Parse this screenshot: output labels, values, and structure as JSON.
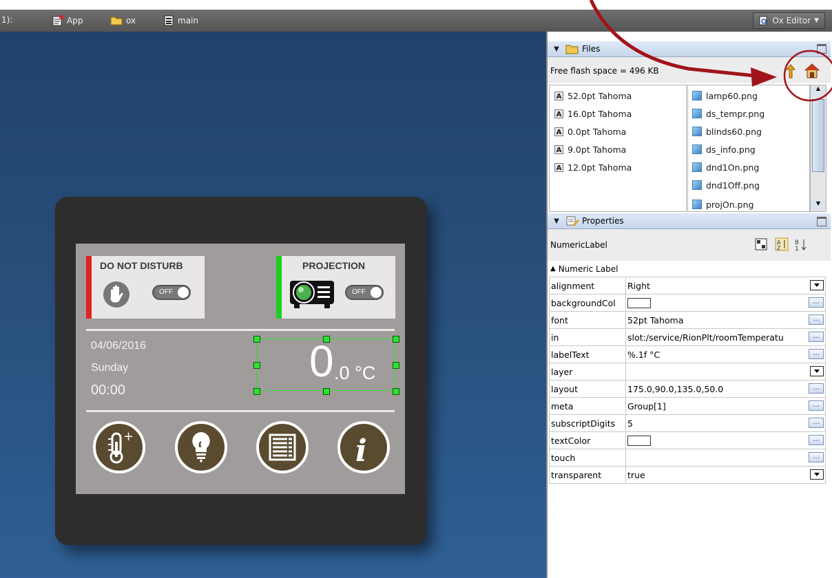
{
  "toolbar": {
    "context_label": "1):",
    "crumbs": [
      "App",
      "ox",
      "main"
    ],
    "editor_button": "Ox Editor"
  },
  "device": {
    "dnd_title": "DO NOT DISTURB",
    "projection_title": "PROJECTION",
    "toggle_off": "OFF",
    "date": "04/06/2016",
    "day": "Sunday",
    "time": "00:00",
    "temp_big": "0",
    "temp_small": ".0 °C",
    "colors": {
      "dnd_accent": "#e02222",
      "projection_accent": "#22cc22",
      "button_fill": "#5a4a30"
    },
    "buttons": [
      "thermometer-plus-icon",
      "lightbulb-icon",
      "blinds-icon",
      "info-icon"
    ]
  },
  "files": {
    "title": "Files",
    "free_space": "Free flash space = 496 KB",
    "fonts": [
      "52.0pt Tahoma",
      "16.0pt Tahoma",
      "0.0pt Tahoma",
      "9.0pt Tahoma",
      "12.0pt Tahoma"
    ],
    "images": [
      "lamp60.png",
      "ds_tempr.png",
      "blinds60.png",
      "ds_info.png",
      "dnd1On.png",
      "dnd1Off.png",
      "projOn.png"
    ]
  },
  "properties": {
    "title": "Properties",
    "object_name": "NumericLabel",
    "section": "Numeric Label",
    "rows": [
      {
        "name": "alignment",
        "value": "Right",
        "editor": "dropdown"
      },
      {
        "name": "backgroundCol",
        "value": "",
        "editor": "dots",
        "swatch": true
      },
      {
        "name": "font",
        "value": "52pt Tahoma",
        "editor": "dots"
      },
      {
        "name": "in",
        "value": "slot:/service/RionPlt/roomTemperatu",
        "editor": "dots"
      },
      {
        "name": "labelText",
        "value": "%.1f °C",
        "editor": "dots"
      },
      {
        "name": "layer",
        "value": "",
        "editor": "dropdown"
      },
      {
        "name": "layout",
        "value": "175.0,90.0,135.0,50.0",
        "editor": "dots"
      },
      {
        "name": "meta",
        "value": "Group[1]",
        "editor": "dots"
      },
      {
        "name": "subscriptDigits",
        "value": "5",
        "editor": "dots"
      },
      {
        "name": "textColor",
        "value": "",
        "editor": "dots",
        "swatch": true
      },
      {
        "name": "touch",
        "value": "",
        "editor": "dots"
      },
      {
        "name": "transparent",
        "value": "true",
        "editor": "dropdown"
      }
    ]
  },
  "annotation": {
    "color": "#a0141a"
  }
}
